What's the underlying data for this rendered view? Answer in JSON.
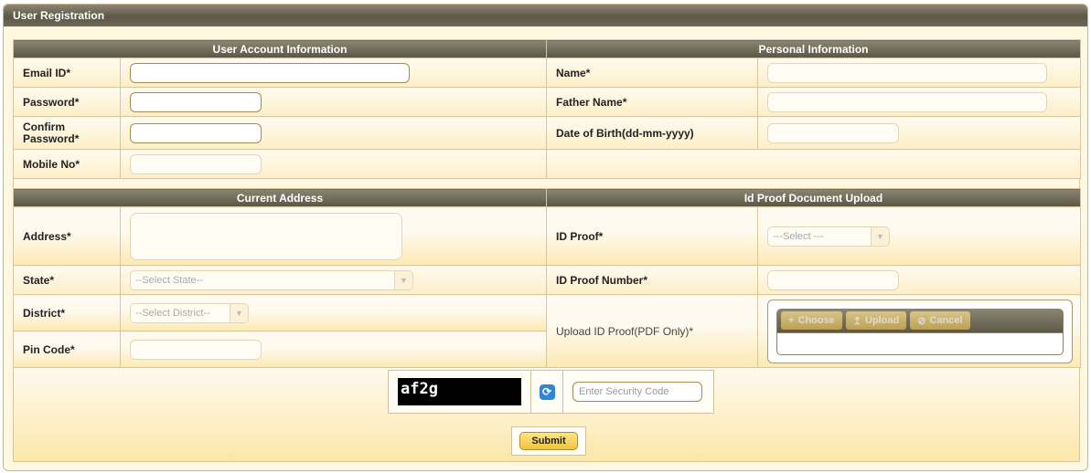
{
  "panel": {
    "title": "User Registration"
  },
  "account": {
    "header": "User Account Information",
    "email_label": "Email ID*",
    "password_label": "Password*",
    "confirm_label": "Confirm Password*",
    "mobile_label": "Mobile No*"
  },
  "personal": {
    "header": "Personal Information",
    "name_label": "Name*",
    "father_label": "Father Name*",
    "dob_label": "Date of Birth(dd-mm-yyyy)"
  },
  "address": {
    "header": "Current Address",
    "address_label": "Address*",
    "state_label": "State*",
    "state_value": "--Select State--",
    "district_label": "District*",
    "district_value": "--Select District--",
    "pin_label": "Pin Code*"
  },
  "idproof": {
    "header": "Id Proof Document Upload",
    "type_label": "ID Proof*",
    "type_value": "---Select ---",
    "number_label": "ID Proof Number*",
    "upload_label": "Upload ID Proof(PDF Only)*",
    "choose_label": "Choose",
    "upload_btn_label": "Upload",
    "cancel_label": "Cancel"
  },
  "captcha": {
    "code": "af2g",
    "placeholder": "Enter Security Code"
  },
  "submit_label": "Submit",
  "icons": {
    "refresh": "refresh-icon",
    "dropdown": "chevron-down-icon",
    "choose": "plus-icon",
    "upload": "upload-icon",
    "cancel": "cancel-icon"
  }
}
